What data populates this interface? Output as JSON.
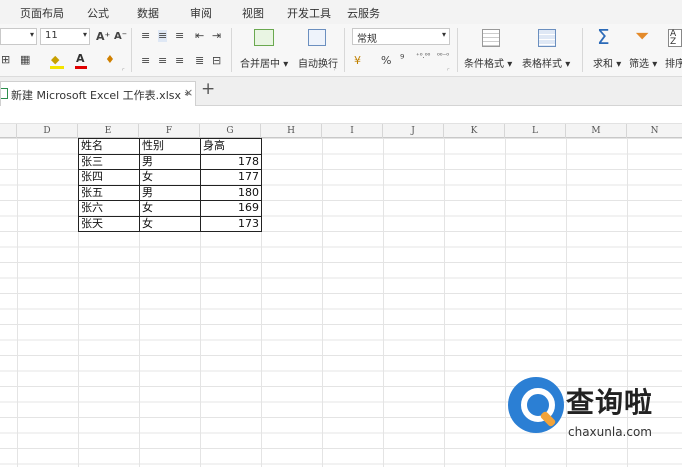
{
  "ribbon_tabs": [
    "页面布局",
    "公式",
    "数据",
    "审阅",
    "视图",
    "开发工具",
    "云服务"
  ],
  "ribbon": {
    "font_size": "11",
    "grow_font": "A⁺",
    "shrink_font": "A⁻",
    "merge_center": "合并居中",
    "wrap_text": "自动换行",
    "number_format": "常规",
    "percent": "%",
    "thousands": "⁹",
    "inc_decimal": "⁺⁰.⁰⁰",
    "dec_decimal": "⁰⁰⁻⁰",
    "conditional_format": "条件格式",
    "table_style": "表格样式",
    "sum": "求和",
    "filter": "筛选",
    "sort": "排序",
    "dropdown_arrow": "▾",
    "group_corner": "⌜"
  },
  "document_tab": {
    "title": "新建 Microsoft Excel 工作表.xlsx *",
    "close": "×",
    "new_tab": "+"
  },
  "column_headers": [
    "D",
    "E",
    "F",
    "G",
    "H",
    "I",
    "J",
    "K",
    "L",
    "M",
    "N"
  ],
  "table": {
    "header": [
      "姓名",
      "性别",
      "身高"
    ],
    "rows": [
      [
        "张三",
        "男",
        "178"
      ],
      [
        "张四",
        "女",
        "177"
      ],
      [
        "张五",
        "男",
        "180"
      ],
      [
        "张六",
        "女",
        "169"
      ],
      [
        "张天",
        "女",
        "173"
      ]
    ]
  },
  "watermark": {
    "title": "查询啦",
    "url": "chaxunla.com"
  },
  "colors": {
    "accent_blue": "#2b7fd4",
    "accent_orange": "#f2a33a",
    "file_icon_green": "#2f8f4f"
  }
}
